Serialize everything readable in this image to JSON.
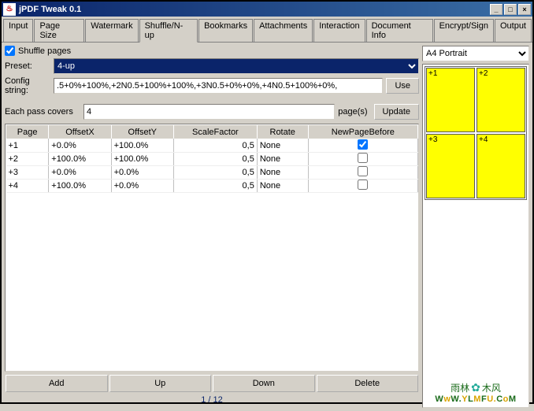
{
  "window": {
    "title": "jPDF Tweak 0.1"
  },
  "tabs": [
    "Input",
    "Page Size",
    "Watermark",
    "Shuffle/N-up",
    "Bookmarks",
    "Attachments",
    "Interaction",
    "Document Info",
    "Encrypt/Sign",
    "Output"
  ],
  "activeTab": 3,
  "shuffle": {
    "checkboxLabel": "Shuffle pages",
    "presetLabel": "Preset:",
    "presetValue": "4-up",
    "configLabel": "Config string:",
    "configValue": ".5+0%+100%,+2N0.5+100%+100%,+3N0.5+0%+0%,+4N0.5+100%+0%,",
    "useLabel": "Use",
    "passLabel": "Each pass covers",
    "passValue": "4",
    "pagesLabel": "page(s)",
    "updateLabel": "Update"
  },
  "tableHeaders": [
    "Page",
    "OffsetX",
    "OffsetY",
    "ScaleFactor",
    "Rotate",
    "NewPageBefore"
  ],
  "rows": [
    {
      "page": "+1",
      "ox": "+0.0%",
      "oy": "+100.0%",
      "sf": "0,5",
      "rot": "None",
      "np": true
    },
    {
      "page": "+2",
      "ox": "+100.0%",
      "oy": "+100.0%",
      "sf": "0,5",
      "rot": "None",
      "np": false
    },
    {
      "page": "+3",
      "ox": "+0.0%",
      "oy": "+0.0%",
      "sf": "0,5",
      "rot": "None",
      "np": false
    },
    {
      "page": "+4",
      "ox": "+100.0%",
      "oy": "+0.0%",
      "sf": "0,5",
      "rot": "None",
      "np": false
    }
  ],
  "bottomButtons": {
    "add": "Add",
    "up": "Up",
    "down": "Down",
    "delete": "Delete"
  },
  "pager": "1 / 12",
  "paper": "A4 Portrait",
  "slots": [
    "+1",
    "+2",
    "+3",
    "+4"
  ],
  "watermark": {
    "brand": "雨林",
    "brand2": "木风",
    "url": "WwW.YLMFU.CoM"
  }
}
